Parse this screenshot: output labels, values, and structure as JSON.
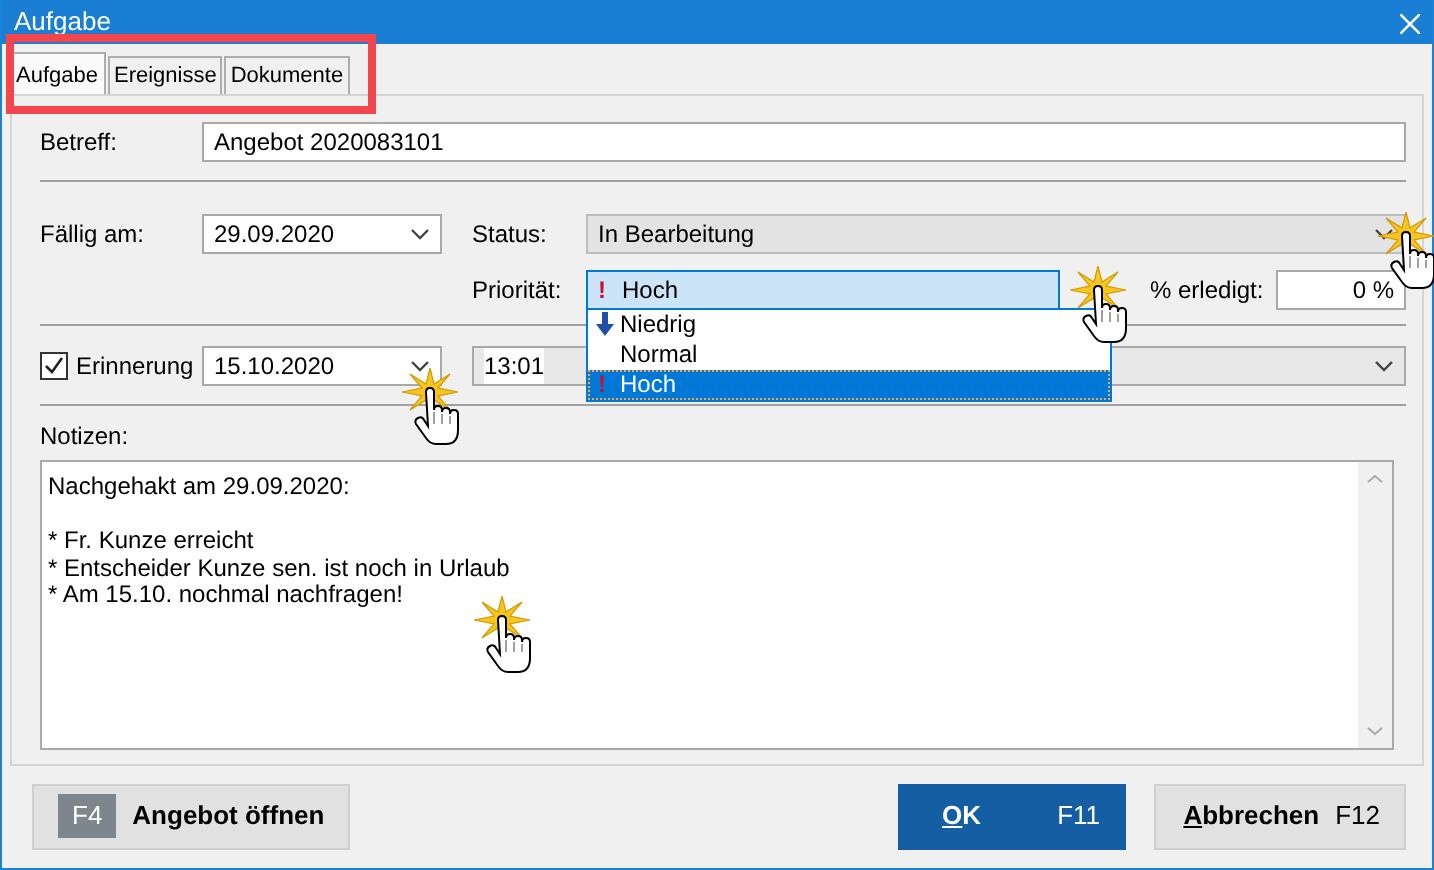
{
  "window": {
    "title": "Aufgabe"
  },
  "tabs_highlighted": true,
  "tabs": [
    {
      "label": "Aufgabe",
      "selected": true
    },
    {
      "label": "Ereignisse",
      "selected": false
    },
    {
      "label": "Dokumente",
      "selected": false
    }
  ],
  "subject": {
    "label": "Betreff:",
    "value": "Angebot 2020083101"
  },
  "due": {
    "label": "Fällig am:",
    "value": "29.09.2020"
  },
  "status": {
    "label": "Status:",
    "value": "In Bearbeitung",
    "disabled": true,
    "clicked": true
  },
  "priority": {
    "label": "Priorität:",
    "mark": "!",
    "value": "Hoch",
    "expanded": true,
    "clicked": true,
    "options": [
      {
        "label": "Niedrig",
        "kind": "low",
        "selected": false
      },
      {
        "label": "Normal",
        "kind": "normal",
        "selected": false
      },
      {
        "label": "Hoch",
        "kind": "high",
        "mark": "!",
        "selected": true
      }
    ]
  },
  "percent": {
    "label": "% erledigt:",
    "value": "0 %"
  },
  "reminder": {
    "label": "Erinnerung",
    "checked": true,
    "date": "15.10.2020",
    "time": "13:01",
    "clicked": true
  },
  "notes": {
    "label": "Notizen:",
    "value": "Nachgehakt am 29.09.2020:\n\n* Fr. Kunze erreicht\n* Entscheider Kunze sen. ist noch in Urlaub\n* Am 15.10. nochmal nachfragen!",
    "clicked": true
  },
  "buttons": [
    {
      "kind": "secondary",
      "key": "F4",
      "label": "Angebot öffnen",
      "mnemonic": false
    },
    {
      "kind": "primary",
      "label": "OK",
      "shortcut": "F11",
      "mnemonic": true
    },
    {
      "kind": "secondary",
      "label": "Abbrechen",
      "shortcut": "F12",
      "mnemonic": true
    }
  ]
}
